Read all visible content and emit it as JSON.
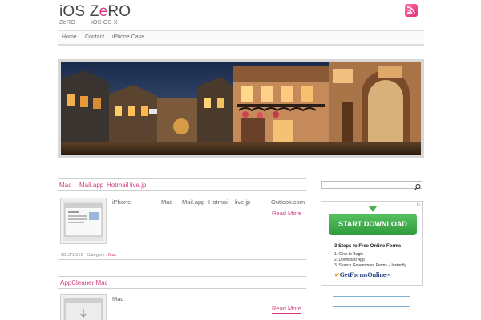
{
  "header": {
    "title_part1": "iOS Z",
    "title_pink": "e",
    "title_part2": "RO",
    "tagline": [
      "ZeRO",
      "iOS OS X"
    ]
  },
  "nav": {
    "items": [
      "Home",
      "Contact",
      "iPhone Case"
    ]
  },
  "posts": [
    {
      "title_words": [
        "Mac",
        "Mail.app",
        "Hotmail",
        "live.jp"
      ],
      "excerpt_words": [
        "iPhone",
        "Mac",
        "Mail.app",
        "Hotmail",
        "live.jp",
        "Outlook.com"
      ],
      "read_more": "Read More",
      "date": "2013/10/10",
      "category_label": "Category :",
      "category": "Mac"
    },
    {
      "title": "AppCleaner Mac",
      "excerpt": "Mac",
      "read_more": "Read More"
    }
  ],
  "ad": {
    "badge": "i▷",
    "button": "START DOWNLOAD",
    "steps_title": "3 Steps to Free Online Forms",
    "steps": [
      "1. Click to Begin",
      "2. Download App",
      "3. Search Government Forms – Instantly"
    ],
    "logo": "GetFormsOnline",
    "logo_tm": "™"
  },
  "colors": {
    "accent": "#d23c7e",
    "ad_green": "#4caf50",
    "ad_logo": "#1d3f7a"
  },
  "icons": {
    "rss": "rss-icon",
    "search": "magnifier-icon"
  }
}
